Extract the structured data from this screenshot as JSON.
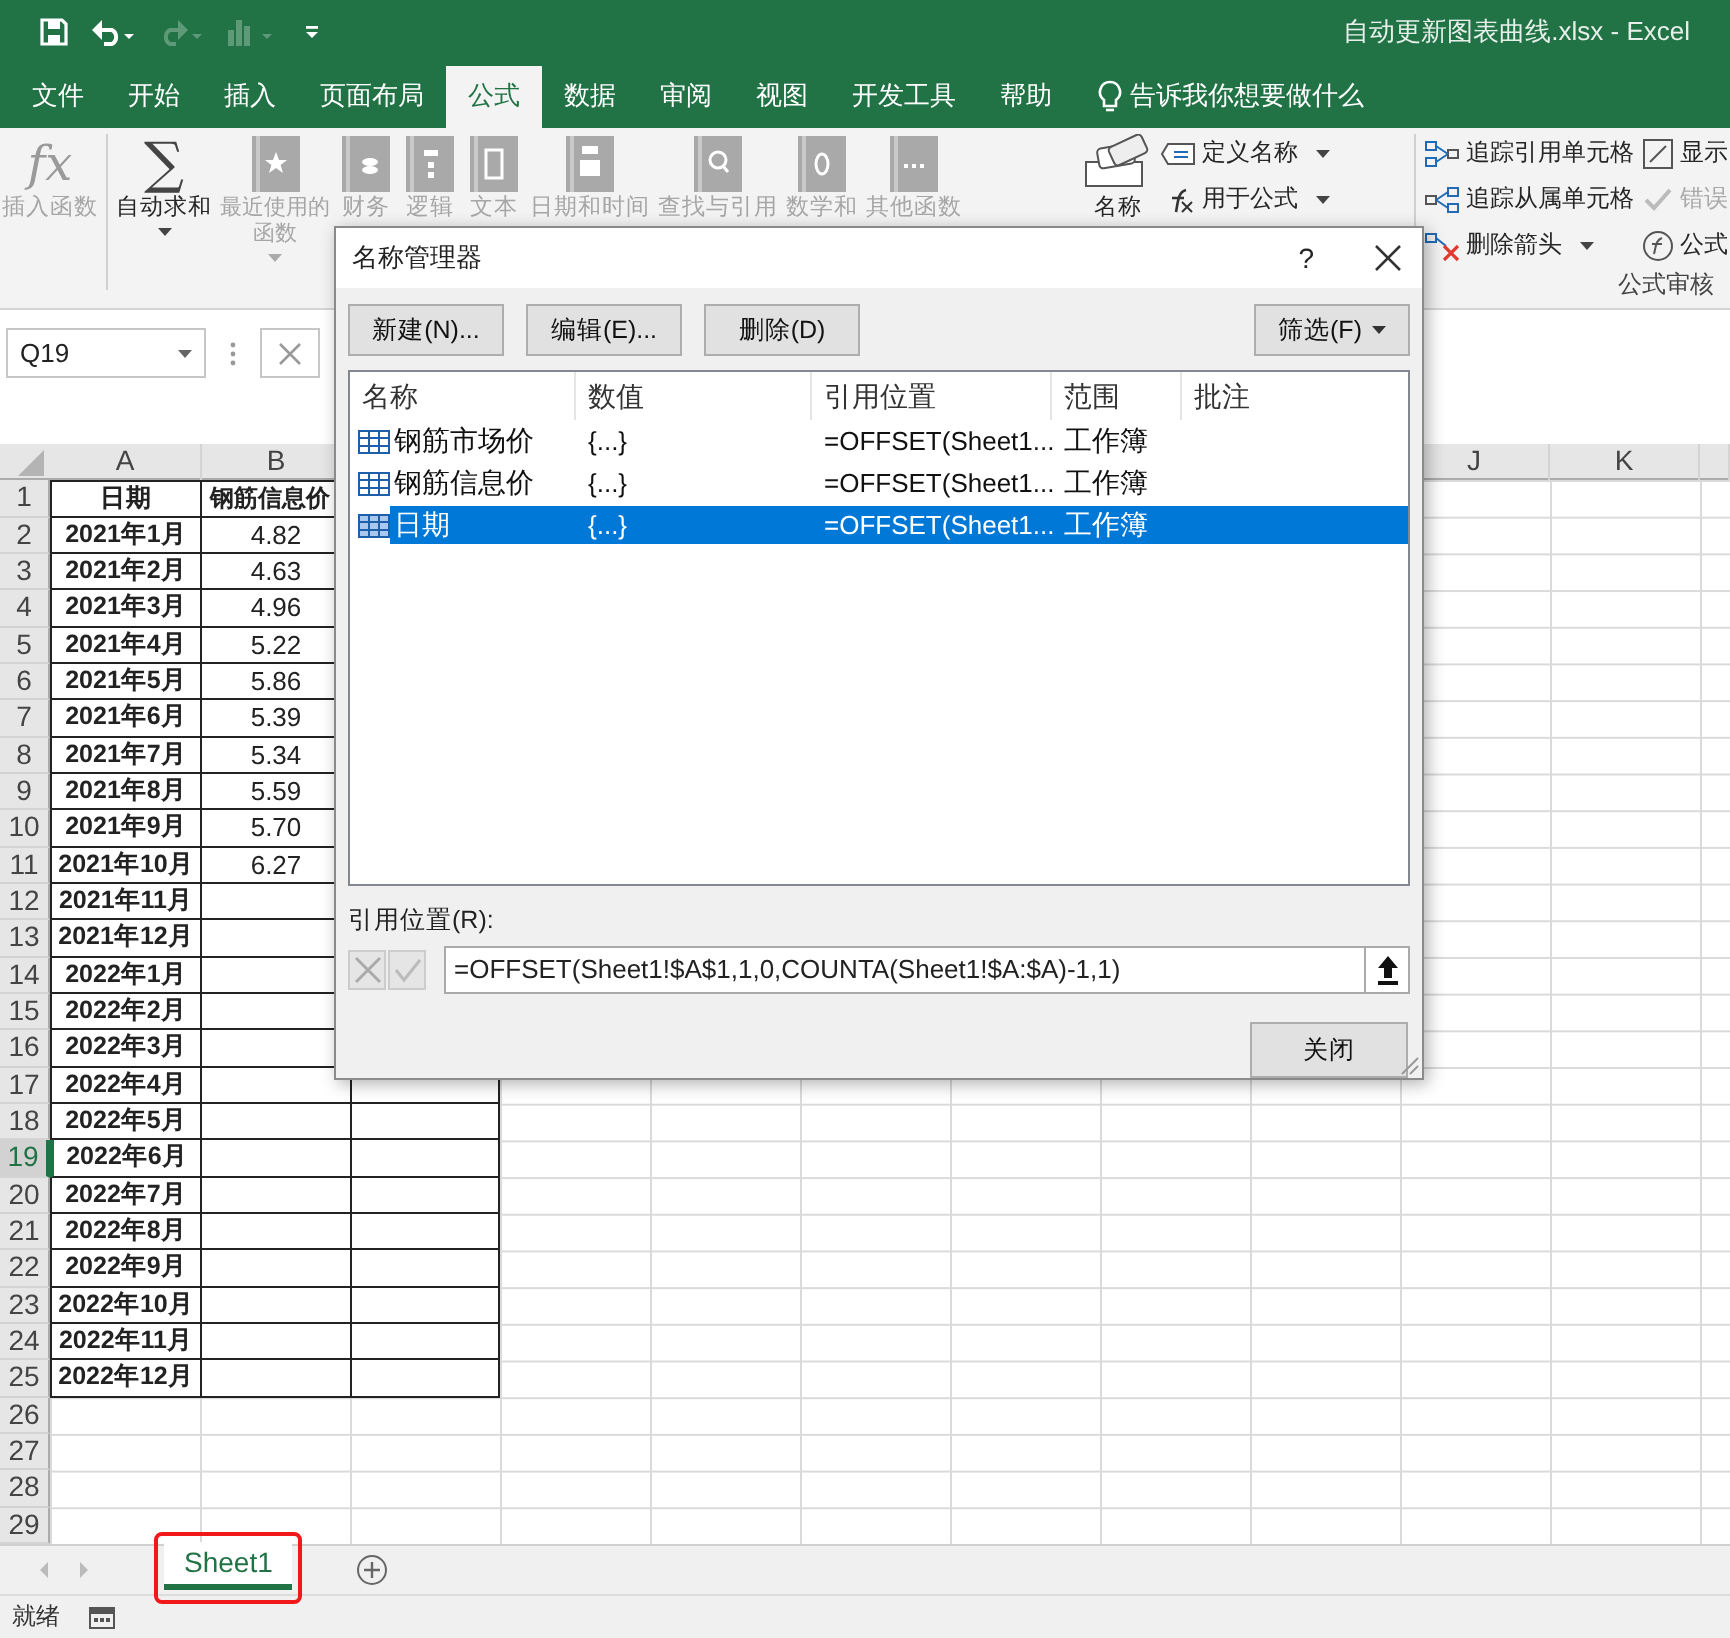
{
  "window": {
    "title": "自动更新图表曲线.xlsx  -  Excel"
  },
  "ribbon_tabs": [
    {
      "label": "文件",
      "selected": false
    },
    {
      "label": "开始",
      "selected": false
    },
    {
      "label": "插入",
      "selected": false
    },
    {
      "label": "页面布局",
      "selected": false
    },
    {
      "label": "公式",
      "selected": true
    },
    {
      "label": "数据",
      "selected": false
    },
    {
      "label": "审阅",
      "selected": false
    },
    {
      "label": "视图",
      "selected": false
    },
    {
      "label": "开发工具",
      "selected": false
    },
    {
      "label": "帮助",
      "selected": false
    }
  ],
  "tell_me": "告诉我你想要做什么",
  "function_library": [
    {
      "kind": "glyph",
      "glyph": "fx",
      "label": "插入函数",
      "disabled": true,
      "dropdown": false
    },
    {
      "kind": "glyph",
      "glyph": "∑",
      "label": "自动求和",
      "disabled": false,
      "dropdown": true
    },
    {
      "kind": "book",
      "label": "最近使用的函数",
      "disabled": true,
      "dropdown": true
    },
    {
      "kind": "book",
      "label": "财务",
      "disabled": true,
      "dropdown": false
    },
    {
      "kind": "book",
      "label": "逻辑",
      "disabled": true,
      "dropdown": false
    },
    {
      "kind": "book",
      "label": "文本",
      "disabled": true,
      "dropdown": false
    },
    {
      "kind": "book",
      "label": "日期和时间",
      "disabled": true,
      "dropdown": false
    },
    {
      "kind": "book",
      "label": "查找与引用",
      "disabled": true,
      "dropdown": false
    },
    {
      "kind": "book",
      "label": "数学和",
      "disabled": true,
      "dropdown": false
    },
    {
      "kind": "book",
      "label": "其他函数",
      "disabled": true,
      "dropdown": false
    }
  ],
  "defined_names": {
    "manager_label": "名称",
    "items": [
      {
        "label": "定义名称",
        "dropdown": true
      },
      {
        "label": "用于公式",
        "dropdown": true
      }
    ]
  },
  "formula_auditing": {
    "items": [
      {
        "label": "追踪引用单元格",
        "disabled": false,
        "dropdown": false
      },
      {
        "label": "追踪从属单元格",
        "disabled": false,
        "dropdown": false
      },
      {
        "label": "删除箭头",
        "disabled": false,
        "dropdown": true
      }
    ],
    "items_right": [
      {
        "label": "显示",
        "disabled": false
      },
      {
        "label": "错误",
        "disabled": true
      },
      {
        "label": "公式",
        "disabled": false
      }
    ],
    "group_label": "公式审核"
  },
  "formula_bar": {
    "name_box": "Q19"
  },
  "sheet": {
    "columns_left": [
      "A",
      "B"
    ],
    "columns_right": [
      "J",
      "K"
    ],
    "rows": [
      {
        "label": "1",
        "selected": false,
        "bordered": true,
        "a": "日期",
        "b": "钢筋信息价"
      },
      {
        "label": "2",
        "selected": false,
        "bordered": true,
        "a": "2021年1月",
        "b": "4.82"
      },
      {
        "label": "3",
        "selected": false,
        "bordered": true,
        "a": "2021年2月",
        "b": "4.63"
      },
      {
        "label": "4",
        "selected": false,
        "bordered": true,
        "a": "2021年3月",
        "b": "4.96"
      },
      {
        "label": "5",
        "selected": false,
        "bordered": true,
        "a": "2021年4月",
        "b": "5.22"
      },
      {
        "label": "6",
        "selected": false,
        "bordered": true,
        "a": "2021年5月",
        "b": "5.86"
      },
      {
        "label": "7",
        "selected": false,
        "bordered": true,
        "a": "2021年6月",
        "b": "5.39"
      },
      {
        "label": "8",
        "selected": false,
        "bordered": true,
        "a": "2021年7月",
        "b": "5.34"
      },
      {
        "label": "9",
        "selected": false,
        "bordered": true,
        "a": "2021年8月",
        "b": "5.59"
      },
      {
        "label": "10",
        "selected": false,
        "bordered": true,
        "a": "2021年9月",
        "b": "5.70"
      },
      {
        "label": "11",
        "selected": false,
        "bordered": true,
        "a": "2021年10月",
        "b": "6.27"
      },
      {
        "label": "12",
        "selected": false,
        "bordered": true,
        "a": "2021年11月"
      },
      {
        "label": "13",
        "selected": false,
        "bordered": true,
        "a": "2021年12月"
      },
      {
        "label": "14",
        "selected": false,
        "bordered": true,
        "a": "2022年1月"
      },
      {
        "label": "15",
        "selected": false,
        "bordered": true,
        "a": "2022年2月"
      },
      {
        "label": "16",
        "selected": false,
        "bordered": true,
        "a": "2022年3月"
      },
      {
        "label": "17",
        "selected": false,
        "bordered": true,
        "a": "2022年4月"
      },
      {
        "label": "18",
        "selected": false,
        "bordered": true,
        "a": "2022年5月"
      },
      {
        "label": "19",
        "selected": true,
        "bordered": true,
        "a": "2022年6月"
      },
      {
        "label": "20",
        "selected": false,
        "bordered": true,
        "a": "2022年7月"
      },
      {
        "label": "21",
        "selected": false,
        "bordered": true,
        "a": "2022年8月"
      },
      {
        "label": "22",
        "selected": false,
        "bordered": true,
        "a": "2022年9月"
      },
      {
        "label": "23",
        "selected": false,
        "bordered": true,
        "a": "2022年10月"
      },
      {
        "label": "24",
        "selected": false,
        "bordered": true,
        "a": "2022年11月"
      },
      {
        "label": "25",
        "selected": false,
        "bordered": true,
        "a": "2022年12月"
      },
      {
        "label": "26",
        "selected": false,
        "bordered": false
      },
      {
        "label": "27",
        "selected": false,
        "bordered": false
      },
      {
        "label": "28",
        "selected": false,
        "bordered": false
      },
      {
        "label": "29",
        "selected": false,
        "bordered": false
      }
    ]
  },
  "sheet_tabs": [
    {
      "label": "Sheet1",
      "selected": true,
      "highlighted": true
    }
  ],
  "status_bar": {
    "text": "就绪"
  },
  "dialog": {
    "title": "名称管理器",
    "help": "?",
    "buttons": [
      "新建(N)...",
      "编辑(E)...",
      "删除(D)"
    ],
    "filter": "筛选(F)",
    "columns": [
      "名称",
      "数值",
      "引用位置",
      "范围",
      "批注"
    ],
    "rows": [
      {
        "name": "钢筋市场价",
        "value": "{...}",
        "refers_to": "=OFFSET(Sheet1...",
        "scope": "工作簿",
        "selected": false
      },
      {
        "name": "钢筋信息价",
        "value": "{...}",
        "refers_to": "=OFFSET(Sheet1...",
        "scope": "工作簿",
        "selected": false
      },
      {
        "name": "日期",
        "value": "{...}",
        "refers_to": "=OFFSET(Sheet1...",
        "scope": "工作簿",
        "selected": true
      }
    ],
    "refers_label": "引用位置(R):",
    "refers_value": "=OFFSET(Sheet1!$A$1,1,0,COUNTA(Sheet1!$A:$A)-1,1)",
    "close": "关闭"
  }
}
